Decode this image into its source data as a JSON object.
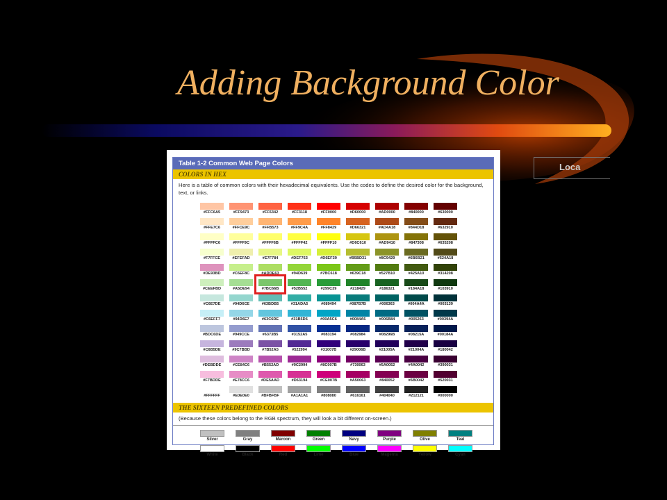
{
  "slide": {
    "title": "Adding Background Color",
    "partial_button_text": "Loca"
  },
  "figure": {
    "header": "Table 1-2   Common Web Page Colors",
    "section1": "COLORS IN HEX",
    "description": "Here is a table of common colors with their hexadecimal equivalents. Use the codes to define the desired color for the background, text, or links.",
    "section2": "THE SIXTEEN PREDEFINED COLORS",
    "section2_note": "(Because these colors belong to the RGB spectrum, they will look a bit different on-screen.)",
    "highlighted": "#7BC66B",
    "hex_rows": [
      [
        "#FFC6A5",
        "#FF9473",
        "#FF6342",
        "#FF3118",
        "#FF0000",
        "#D60000",
        "#AD0000",
        "#840000",
        "#630000"
      ],
      [
        "#FFE7C6",
        "#FFCE9C",
        "#FFB573",
        "#FF9C4A",
        "#FF8429",
        "#D66321",
        "#AD4A18",
        "#844D18",
        "#632910"
      ],
      [
        "#FFFFC6",
        "#FFFF9C",
        "#FFFF6B",
        "#FFFF42",
        "#FFFF10",
        "#D6C610",
        "#AD9410",
        "#847308",
        "#635208"
      ],
      [
        "#F7FFCE",
        "#EFEFAD",
        "#E7F784",
        "#DEF763",
        "#D6EF39",
        "#B5BD31",
        "#8C9429",
        "#6B6B21",
        "#524A18"
      ],
      [
        "#DE93BD",
        "#C6EF8C",
        "#ADDE63",
        "#94D639",
        "#7BC618",
        "#639C18",
        "#527B10",
        "#425A10",
        "#314208"
      ],
      [
        "#CEEFBD",
        "#A5DE94",
        "#7BC66B",
        "#52B552",
        "#299C39",
        "#218429",
        "#186321",
        "#184A18",
        "#103910"
      ],
      [
        "#C6E7DE",
        "#94D6CE",
        "#63BDB5",
        "#31ADA5",
        "#089494",
        "#087B7B",
        "#006363",
        "#004A4A",
        "#003139"
      ],
      [
        "#C6EFF7",
        "#94D6E7",
        "#63C6DE",
        "#31B5D6",
        "#00A5C6",
        "#0084A5",
        "#006B84",
        "#005263",
        "#00394A"
      ],
      [
        "#BDC6DE",
        "#949CCE",
        "#6373B5",
        "#3152A5",
        "#083194",
        "#082984",
        "#08296B",
        "#08215A",
        "#00184A"
      ],
      [
        "#C6B5DE",
        "#9C7BBD",
        "#7B52A5",
        "#522994",
        "#31007B",
        "#29006B",
        "#21005A",
        "#21004A",
        "#180042"
      ],
      [
        "#DEBDDE",
        "#CE84C6",
        "#B552AD",
        "#9C2994",
        "#8C007B",
        "#730063",
        "#5A0052",
        "#4A0042",
        "#390031"
      ],
      [
        "#F7BDDE",
        "#E78CC6",
        "#DE5AAD",
        "#D63194",
        "#CE007B",
        "#A50063",
        "#840052",
        "#6B0042",
        "#520031"
      ],
      [
        "#FFFFFF",
        "#E0E0E0",
        "#BFBFBF",
        "#A1A1A1",
        "#808080",
        "#616161",
        "#404040",
        "#212121",
        "#000000"
      ]
    ],
    "predefined_rows": [
      [
        {
          "name": "Silver",
          "color": "#C0C0C0"
        },
        {
          "name": "Gray",
          "color": "#808080"
        },
        {
          "name": "Maroon",
          "color": "#800000"
        },
        {
          "name": "Green",
          "color": "#008000"
        },
        {
          "name": "Navy",
          "color": "#000080"
        },
        {
          "name": "Purple",
          "color": "#800080"
        },
        {
          "name": "Olive",
          "color": "#808000"
        },
        {
          "name": "Teal",
          "color": "#008080"
        }
      ],
      [
        {
          "name": "White",
          "color": "#FFFFFF"
        },
        {
          "name": "Black",
          "color": "#000000"
        },
        {
          "name": "Red",
          "color": "#FF0000"
        },
        {
          "name": "Lime",
          "color": "#00FF00"
        },
        {
          "name": "Blue",
          "color": "#0000FF"
        },
        {
          "name": "Magenta",
          "color": "#FF00FF"
        },
        {
          "name": "Yellow",
          "color": "#FFFF00"
        },
        {
          "name": "Cyan",
          "color": "#00FFFF"
        }
      ]
    ]
  }
}
